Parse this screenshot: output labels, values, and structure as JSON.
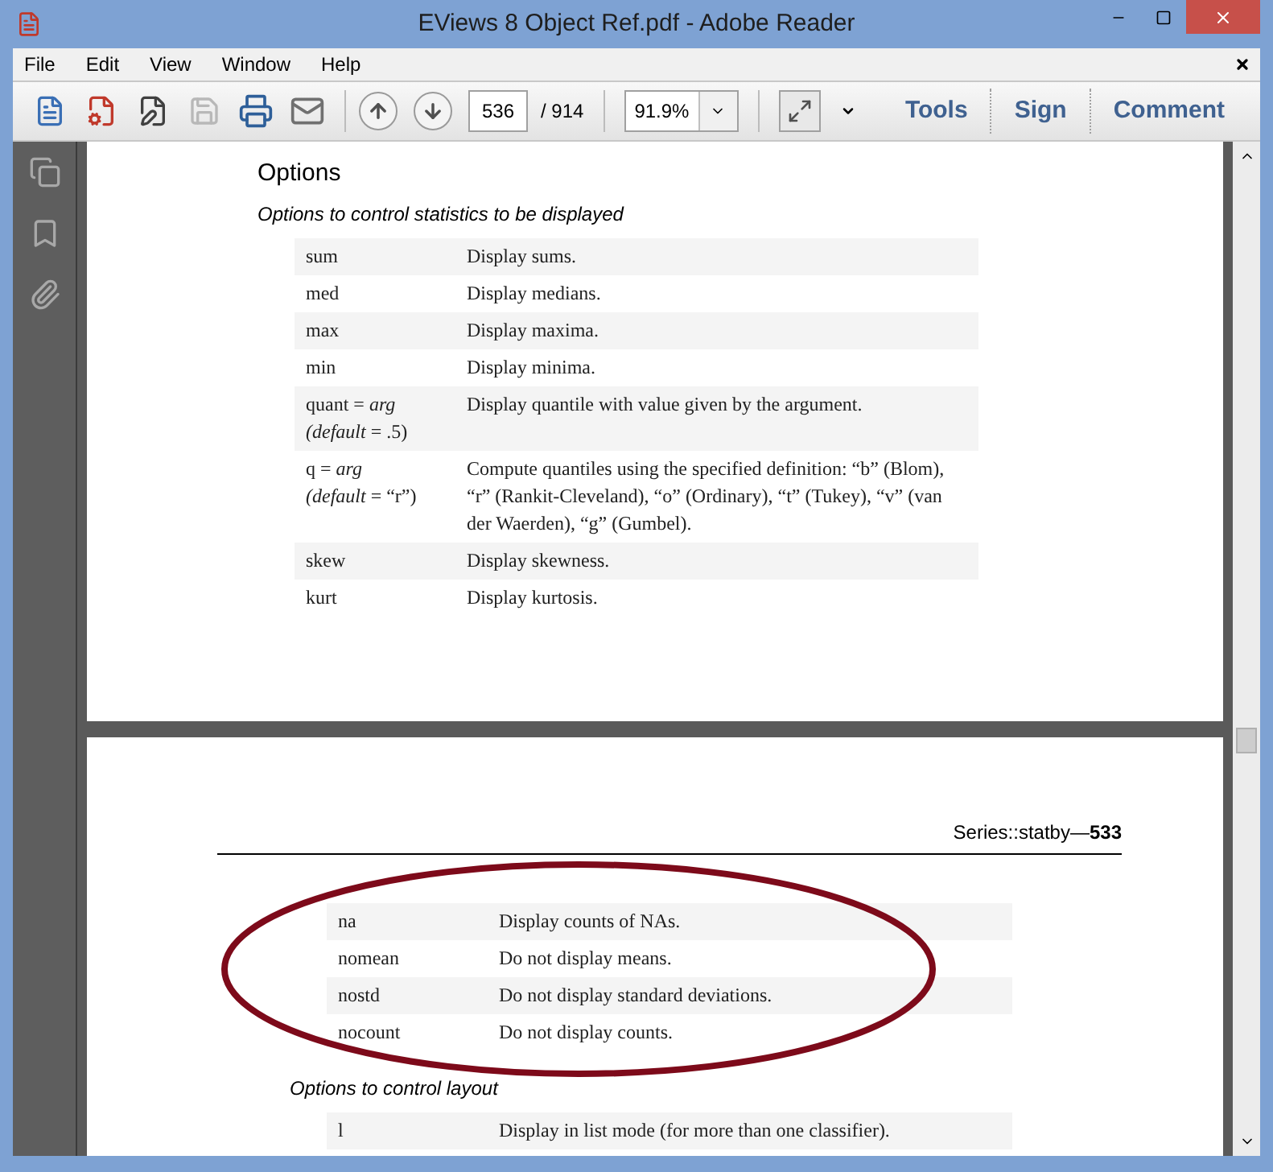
{
  "window": {
    "title": "EViews 8 Object Ref.pdf - Adobe Reader"
  },
  "menu": [
    "File",
    "Edit",
    "View",
    "Window",
    "Help"
  ],
  "toolbar": {
    "save_disabled": true,
    "page": "536",
    "total": "/ 914",
    "zoom": "91.9%",
    "panes": [
      "Tools",
      "Sign",
      "Comment"
    ]
  },
  "page_1": {
    "heading": "Options",
    "subtitle": "Options to control statistics to be displayed",
    "rows": [
      {
        "option": "sum",
        "description": "Display sums."
      },
      {
        "option": "med",
        "description": "Display medians."
      },
      {
        "option": "max",
        "description": "Display maxima."
      },
      {
        "option": "min",
        "description": "Display minima."
      },
      {
        "option": "quant = *arg*",
        "option_note": "*(default* = .5)",
        "description": "Display quantile with value given by the argument."
      },
      {
        "option": "q = *arg*",
        "option_note": "*(default* = “r”)",
        "description": "Compute quantiles using the specified definition: “b” (Blom), “r” (Rankit-Cleveland), “o” (Ordinary), “t” (Tukey), “v” (van der Waerden), “g” (Gumbel)."
      },
      {
        "option": "skew",
        "description": "Display skewness."
      },
      {
        "option": "kurt",
        "description": "Display kurtosis."
      }
    ]
  },
  "page_2": {
    "running_header": "Series::statby—**533**",
    "rows": [
      {
        "option": "na",
        "description": "Display counts of NAs."
      },
      {
        "option": "nomean",
        "description": "Do not display means."
      },
      {
        "option": "nostd",
        "description": "Do not display standard deviations."
      },
      {
        "option": "nocount",
        "description": "Do not display counts."
      }
    ],
    "subtitle": "Options to control layout",
    "rows_2": [
      {
        "option": "l",
        "description": "Display in list mode (for more than one classifier)."
      }
    ]
  }
}
